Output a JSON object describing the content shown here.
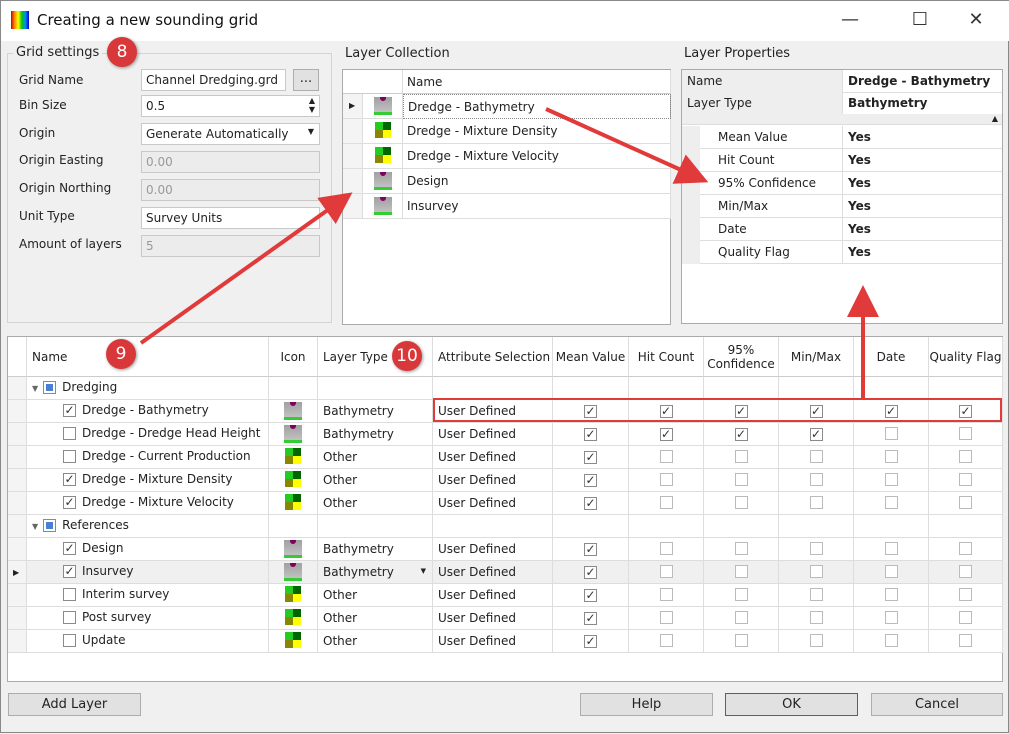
{
  "window": {
    "title": "Creating a new sounding grid",
    "min": "—",
    "max": "☐",
    "close": "✕"
  },
  "grid_settings": {
    "title": "Grid settings",
    "badge": "8",
    "grid_name_label": "Grid Name",
    "grid_name": "Channel Dredging.grd",
    "browse": "...",
    "bin_size_label": "Bin Size",
    "bin_size": "0.5",
    "origin_label": "Origin",
    "origin": "Generate Automatically",
    "easting_label": "Origin Easting",
    "easting": "0.00",
    "northing_label": "Origin Northing",
    "northing": "0.00",
    "unit_label": "Unit Type",
    "unit": "Survey Units",
    "layers_label": "Amount of layers",
    "layers": "5"
  },
  "layer_collection": {
    "title": "Layer Collection",
    "name_header": "Name",
    "items": [
      {
        "name": "Dredge - Bathymetry",
        "icon": "bathy"
      },
      {
        "name": "Dredge - Mixture Density",
        "icon": "other"
      },
      {
        "name": "Dredge - Mixture Velocity",
        "icon": "other"
      },
      {
        "name": "Design",
        "icon": "bathy"
      },
      {
        "name": "Insurvey",
        "icon": "bathy"
      }
    ]
  },
  "layer_properties": {
    "title": "Layer Properties",
    "name_label": "Name",
    "name": "Dredge - Bathymetry",
    "type_label": "Layer Type",
    "type": "Bathymetry",
    "attrs": [
      {
        "k": "Mean Value",
        "v": "Yes"
      },
      {
        "k": "Hit Count",
        "v": "Yes"
      },
      {
        "k": "95% Confidence",
        "v": "Yes"
      },
      {
        "k": "Min/Max",
        "v": "Yes"
      },
      {
        "k": "Date",
        "v": "Yes"
      },
      {
        "k": "Quality Flag",
        "v": "Yes"
      }
    ]
  },
  "table": {
    "badge9": "9",
    "badge10": "10",
    "headers": [
      "Name",
      "Icon",
      "Layer Type",
      "Attribute Selection",
      "Mean Value",
      "Hit Count",
      "95% Confidence",
      "Min/Max",
      "Date",
      "Quality Flag"
    ],
    "rows": [
      {
        "group": "Dredging"
      },
      {
        "name": "Dredge - Bathymetry",
        "checked": true,
        "icon": "bathy",
        "type": "Bathymetry",
        "attr": "User Defined",
        "flags": [
          1,
          1,
          1,
          1,
          1,
          1
        ]
      },
      {
        "name": "Dredge - Dredge Head Height",
        "checked": false,
        "icon": "bathy",
        "type": "Bathymetry",
        "attr": "User Defined",
        "flags": [
          1,
          1,
          1,
          1,
          0,
          0
        ]
      },
      {
        "name": "Dredge - Current Production",
        "checked": false,
        "icon": "other",
        "type": "Other",
        "attr": "User Defined",
        "flags": [
          1,
          0,
          0,
          0,
          0,
          0
        ]
      },
      {
        "name": "Dredge - Mixture Density",
        "checked": true,
        "icon": "other",
        "type": "Other",
        "attr": "User Defined",
        "flags": [
          1,
          0,
          0,
          0,
          0,
          0
        ]
      },
      {
        "name": "Dredge - Mixture Velocity",
        "checked": true,
        "icon": "other",
        "type": "Other",
        "attr": "User Defined",
        "flags": [
          1,
          0,
          0,
          0,
          0,
          0
        ]
      },
      {
        "group": "References"
      },
      {
        "name": "Design",
        "checked": true,
        "icon": "bathy",
        "type": "Bathymetry",
        "attr": "User Defined",
        "flags": [
          1,
          0,
          0,
          0,
          0,
          0
        ]
      },
      {
        "name": "Insurvey",
        "checked": true,
        "icon": "bathy",
        "type": "Bathymetry",
        "attr": "User Defined",
        "flags": [
          1,
          0,
          0,
          0,
          0,
          0
        ],
        "current": true
      },
      {
        "name": "Interim survey",
        "checked": false,
        "icon": "other",
        "type": "Other",
        "attr": "User Defined",
        "flags": [
          1,
          0,
          0,
          0,
          0,
          0
        ]
      },
      {
        "name": "Post survey",
        "checked": false,
        "icon": "other",
        "type": "Other",
        "attr": "User Defined",
        "flags": [
          1,
          0,
          0,
          0,
          0,
          0
        ]
      },
      {
        "name": "Update",
        "checked": false,
        "icon": "other",
        "type": "Other",
        "attr": "User Defined",
        "flags": [
          1,
          0,
          0,
          0,
          0,
          0
        ]
      }
    ]
  },
  "buttons": {
    "add_layer": "Add Layer",
    "help": "Help",
    "ok": "OK",
    "cancel": "Cancel"
  }
}
